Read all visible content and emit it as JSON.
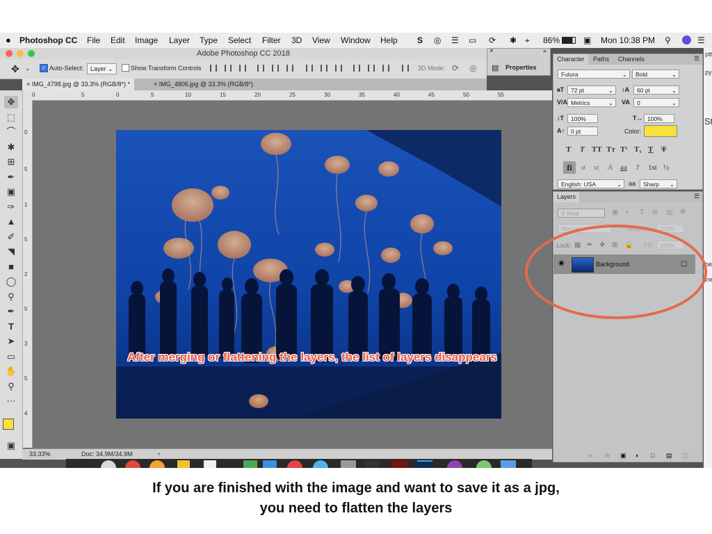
{
  "menubar": {
    "app_name": "Photoshop CC",
    "menus": [
      "File",
      "Edit",
      "Image",
      "Layer",
      "Type",
      "Select",
      "Filter",
      "3D",
      "View",
      "Window",
      "Help"
    ],
    "battery": "86%",
    "clock": "Mon 10:38 PM"
  },
  "window": {
    "title": "Adobe Photoshop CC 2018"
  },
  "options_bar": {
    "auto_select_label": "Auto-Select:",
    "auto_select_value": "Layer",
    "show_transform_label": "Show Transform Controls",
    "three_d_mode_label": "3D Mode:"
  },
  "doc_tabs": [
    {
      "label": "IMG_4798.jpg @ 33.3% (RGB/8*) *"
    },
    {
      "label": "IMG_4806.jpg @ 33.3% (RGB/8*)"
    }
  ],
  "ruler": {
    "h_ticks": [
      "0",
      "5",
      "0",
      "5",
      "10",
      "15",
      "20",
      "25",
      "30",
      "35",
      "40",
      "45",
      "50",
      "55"
    ],
    "v_ticks": [
      "0",
      "5",
      "1",
      "5",
      "2",
      "5",
      "3",
      "5",
      "4"
    ]
  },
  "status_bar": {
    "zoom": "33.33%",
    "doc_size": "Doc: 34.9M/34.9M"
  },
  "properties": {
    "label": "Properties"
  },
  "character_panel": {
    "tabs": [
      "Character",
      "Paths",
      "Channels"
    ],
    "font_family": "Futura",
    "font_style": "Bold",
    "font_size": "72 pt",
    "leading": "60 pt",
    "kerning": "Metrics",
    "tracking": "0",
    "vertical_scale": "100%",
    "horizontal_scale": "100%",
    "baseline_shift": "0 pt",
    "color_label": "Color:",
    "text_color": "#f7e03a",
    "language": "English: USA",
    "antialias_prefix": "aa",
    "antialias": "Sharp",
    "style_buttons": [
      "T",
      "T",
      "TT",
      "Tт",
      "T¹",
      "T₁",
      "T",
      "T"
    ],
    "opentype_buttons": [
      "fi",
      "σ",
      "st",
      "A",
      "aa",
      "T",
      "1st",
      "½"
    ]
  },
  "layers_panel": {
    "title": "Layers",
    "kind_label": "Kind",
    "blend_mode": "Normal",
    "opacity_label": "Opacity:",
    "opacity": "100%",
    "lock_label": "Lock:",
    "fill_label": "Fill:",
    "fill": "100%",
    "layers": [
      {
        "name": "Background",
        "visible": true,
        "locked": true
      }
    ]
  },
  "right_edge": {
    "snippets": [
      "ptt",
      "py",
      "St",
      "pe",
      "ine"
    ]
  },
  "annotation": {
    "text": "After merging or flattening the layers, the list of layers disappears",
    "color": "#ee5a46"
  },
  "caption": {
    "line1": "If you are finished with the image and want to save it as a jpg,",
    "line2": "you need to flatten the layers"
  }
}
